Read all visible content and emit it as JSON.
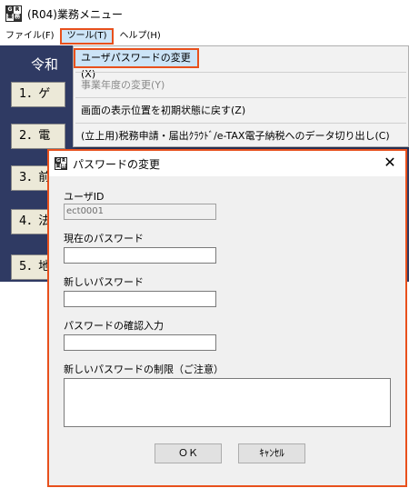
{
  "window": {
    "title": "(R04)業務メニュー",
    "icon": "app-icon",
    "icon_chars": [
      "G",
      "R",
      "業",
      "務"
    ]
  },
  "menubar": {
    "items": [
      "ファイル(F)",
      "ツール(T)",
      "ヘルプ(H)"
    ]
  },
  "background": {
    "title": "令和",
    "buttons": [
      "1．ゲ",
      "2．電",
      "3．前の",
      "4．法",
      "5．地"
    ]
  },
  "dropdown": {
    "items": [
      "ユーザパスワードの変更(X)",
      "事業年度の変更(Y)",
      "画面の表示位置を初期状態に戻す(Z)",
      "(立上用)税務申請・届出ｸﾗｳﾄﾞ/e-TAX電子納税へのデータ切り出し(C)"
    ]
  },
  "dialog": {
    "title": "パスワードの変更",
    "close_glyph": "✕",
    "user_id_label": "ユーザID",
    "user_id_value": "ect0001",
    "current_password_label": "現在のパスワード",
    "current_password_value": "",
    "new_password_label": "新しいパスワード",
    "new_password_value": "",
    "confirm_password_label": "パスワードの確認入力",
    "confirm_password_value": "",
    "restriction_label": "新しいパスワードの制限（ご注意）",
    "ok_label": "ＯＫ",
    "cancel_label": "ｷｬﾝｾﾙ"
  },
  "colors": {
    "highlight_border": "#e8501c",
    "selection": "#cce4f7",
    "background_app": "#2f3a63"
  }
}
